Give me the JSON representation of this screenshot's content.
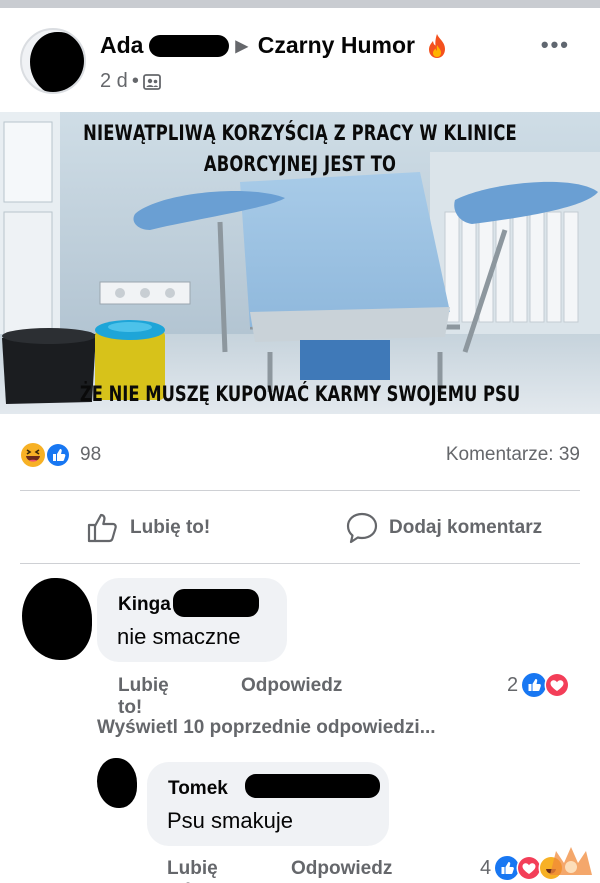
{
  "post": {
    "author": "Ada",
    "group": "Czarny Humor",
    "time": "2 d",
    "separator": "•",
    "more_glyph": "•••",
    "icons": [
      "fire-icon",
      "group-icon",
      "more-icon"
    ]
  },
  "meme": {
    "top_line1": "NIEWĄTPLIWĄ KORZYŚCIĄ Z PRACY W KLINICE",
    "top_line2": "ABORCYJNEJ JEST TO",
    "bottom_line": "ŻE NIE MUSZĘ KUPOWAĆ KARMY SWOJEMU PSU"
  },
  "reactions": {
    "count": "98",
    "comments": "Komentarze: 39",
    "types": [
      "haha",
      "like"
    ]
  },
  "actions": {
    "like": "Lubię to!",
    "comment": "Dodaj komentarz"
  },
  "comments": [
    {
      "name": "Kinga",
      "text": "nie smaczne",
      "like_label": "Lubię to!",
      "reply_label": "Odpowiedz",
      "reaction_count": "2",
      "reaction_types": [
        "like",
        "love"
      ]
    },
    {
      "name": "Tomek",
      "text": "Psu smakuje",
      "like_label": "Lubię to!",
      "reply_label": "Odpowiedz",
      "reaction_count": "4",
      "reaction_types": [
        "like",
        "love",
        "haha"
      ]
    }
  ],
  "view_more_replies": "Wyświetl 10 poprzednie odpowiedzi...",
  "colors": {
    "secondary_text": "#65676b",
    "bubble": "#f0f2f5",
    "like_blue": "#1877f2",
    "love_red": "#f33e58",
    "haha_yellow": "#f7b125",
    "divider": "#ced0d4"
  }
}
